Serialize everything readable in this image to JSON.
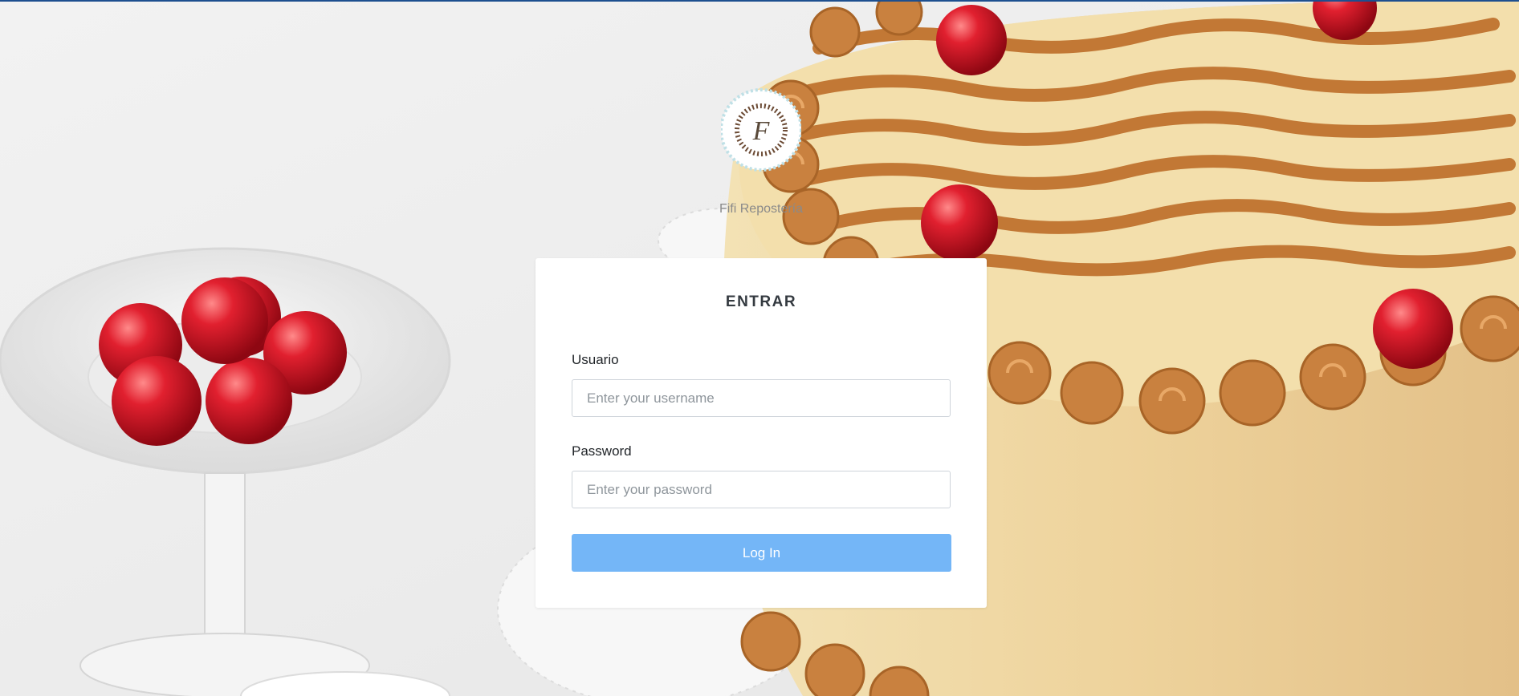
{
  "brand": {
    "name": "Fifi Repostería",
    "logo_letter": "F"
  },
  "login": {
    "title": "ENTRAR",
    "username_label": "Usuario",
    "username_placeholder": "Enter your username",
    "username_value": "",
    "password_label": "Password",
    "password_placeholder": "Enter your password",
    "password_value": "",
    "submit_label": "Log In"
  },
  "colors": {
    "button_bg": "#74b6f7",
    "top_line": "#1d4f8f",
    "caramel": "#c17a3a",
    "cream": "#f1dba6",
    "cherry": "#c8101f"
  }
}
